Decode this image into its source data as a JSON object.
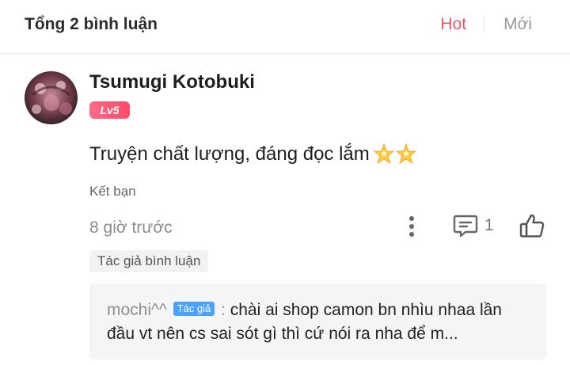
{
  "header": {
    "total_label": "Tổng 2 bình luận",
    "sort_hot": "Hot",
    "sort_new": "Mới",
    "hot_color": "#e85a6e"
  },
  "comment": {
    "username": "Tsumugi Kotobuki",
    "level": "Lv5",
    "text": "Truyện chất lượng, đáng đọc lắm",
    "emoji": "star-sparkle-icon",
    "friend_label": "Kết bạn",
    "time": "8 giờ trước",
    "reply_count": "1",
    "author_replied_tag": "Tác giả bình luận"
  },
  "reply": {
    "user": "mochi^^",
    "author_badge": "Tác giả",
    "separator": " : ",
    "text": "chài ai shop camon bn nhìu nhaa lần đầu vt nên cs sai sót gì thì cứ nói ra nha để m..."
  }
}
